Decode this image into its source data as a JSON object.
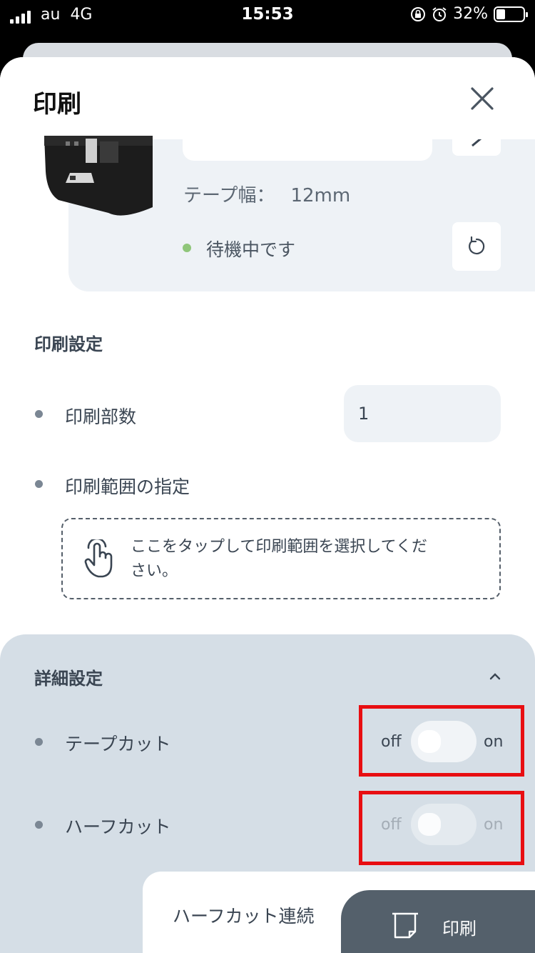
{
  "status_bar": {
    "carrier": "au",
    "network": "4G",
    "time": "15:53",
    "battery": "32%"
  },
  "header": {
    "title": "印刷"
  },
  "printer": {
    "tape_width_label": "テープ幅：",
    "tape_width_value": "12mm",
    "status": "待機中です",
    "status_color": "#8fc67a"
  },
  "print_settings": {
    "title": "印刷設定",
    "copies_label": "印刷部数",
    "copies_value": "1",
    "range_label": "印刷範囲の指定",
    "range_hint": "ここをタップして印刷範囲を選択してください。"
  },
  "advanced": {
    "title": "詳細設定",
    "tape_cut": {
      "label": "テープカット",
      "off": "off",
      "on": "on",
      "state": "off"
    },
    "half_cut": {
      "label": "ハーフカット",
      "off": "off",
      "on": "on",
      "state": "off",
      "disabled": true
    },
    "half_cut_continuous": "ハーフカット連続"
  },
  "footer": {
    "print_button": "印刷"
  },
  "colors": {
    "accent_dark": "#54606b",
    "highlight": "#e80e12",
    "panel": "#d5dee6"
  }
}
